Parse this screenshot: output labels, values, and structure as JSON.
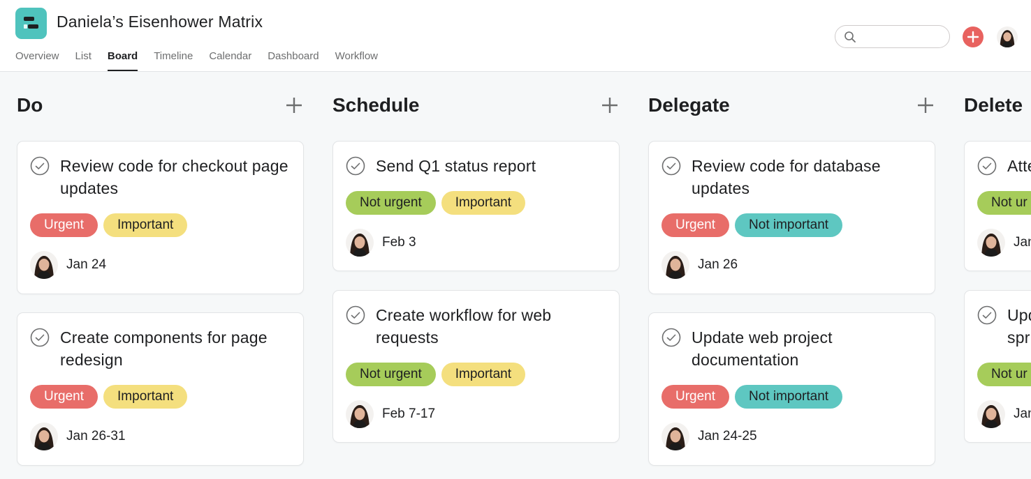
{
  "header": {
    "project_title": "Daniela’s Eisenhower Matrix",
    "tabs": [
      {
        "label": "Overview",
        "active": false
      },
      {
        "label": "List",
        "active": false
      },
      {
        "label": "Board",
        "active": true
      },
      {
        "label": "Timeline",
        "active": false
      },
      {
        "label": "Calendar",
        "active": false
      },
      {
        "label": "Dashboard",
        "active": false
      },
      {
        "label": "Workflow",
        "active": false
      }
    ],
    "search": {
      "value": "",
      "placeholder": ""
    },
    "icons": {
      "logo": "project-logo-icon",
      "search": "search-icon",
      "add": "plus-circle-icon",
      "avatar": "user-avatar"
    }
  },
  "colors": {
    "accent": "#4fc3bd",
    "add_button": "#e8625f",
    "urgent": "#e86d69",
    "important": "#f4df7e",
    "not_urgent": "#a6cc5a",
    "not_important": "#5ec7c1"
  },
  "board": {
    "columns": [
      {
        "title": "Do",
        "cards": [
          {
            "title": "Review code for checkout page updates",
            "tags": [
              "Urgent",
              "Important"
            ],
            "due": "Jan 24"
          },
          {
            "title": "Create components for page redesign",
            "tags": [
              "Urgent",
              "Important"
            ],
            "due": "Jan 26-31"
          }
        ]
      },
      {
        "title": "Schedule",
        "cards": [
          {
            "title": "Send Q1 status report",
            "tags": [
              "Not urgent",
              "Important"
            ],
            "due": "Feb 3"
          },
          {
            "title": "Create workflow for web requests",
            "tags": [
              "Not urgent",
              "Important"
            ],
            "due": "Feb 7-17"
          }
        ]
      },
      {
        "title": "Delegate",
        "cards": [
          {
            "title": "Review code for database updates",
            "tags": [
              "Urgent",
              "Not important"
            ],
            "due": "Jan 26"
          },
          {
            "title": "Update web project documentation",
            "tags": [
              "Urgent",
              "Not important"
            ],
            "due": "Jan 24-25"
          }
        ]
      },
      {
        "title": "Delete",
        "cards": [
          {
            "title": "Atte",
            "tags": [
              "Not ur"
            ],
            "due": "Jan"
          },
          {
            "title": "Upd spr",
            "tags": [
              "Not ur"
            ],
            "due": "Jan"
          }
        ]
      }
    ]
  }
}
